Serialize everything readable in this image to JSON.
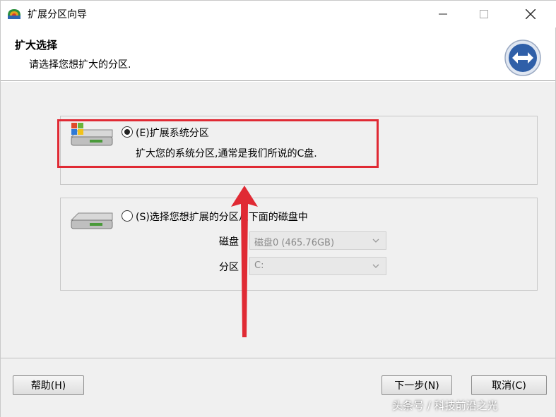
{
  "window": {
    "title": "扩展分区向导"
  },
  "header": {
    "title": "扩大选择",
    "subtitle": "请选择您想扩大的分区."
  },
  "options": [
    {
      "label": "(E)扩展系统分区",
      "description": "扩大您的系统分区,通常是我们所说的C盘.",
      "selected": true
    },
    {
      "label": "(S)选择您想扩展的分区从下面的磁盘中",
      "selected": false,
      "fields": {
        "disk_label": "磁盘",
        "disk_value": "磁盘0 (465.76GB)",
        "partition_label": "分区",
        "partition_value": "C:"
      }
    }
  ],
  "buttons": {
    "help": "帮助(H)",
    "next": "下一步(N)",
    "cancel": "取消(C)"
  },
  "watermark": "头条号 / 科技前沿之光",
  "colors": {
    "annotation_red": "#e02a34",
    "dialog_bg": "#f0f0f0"
  }
}
